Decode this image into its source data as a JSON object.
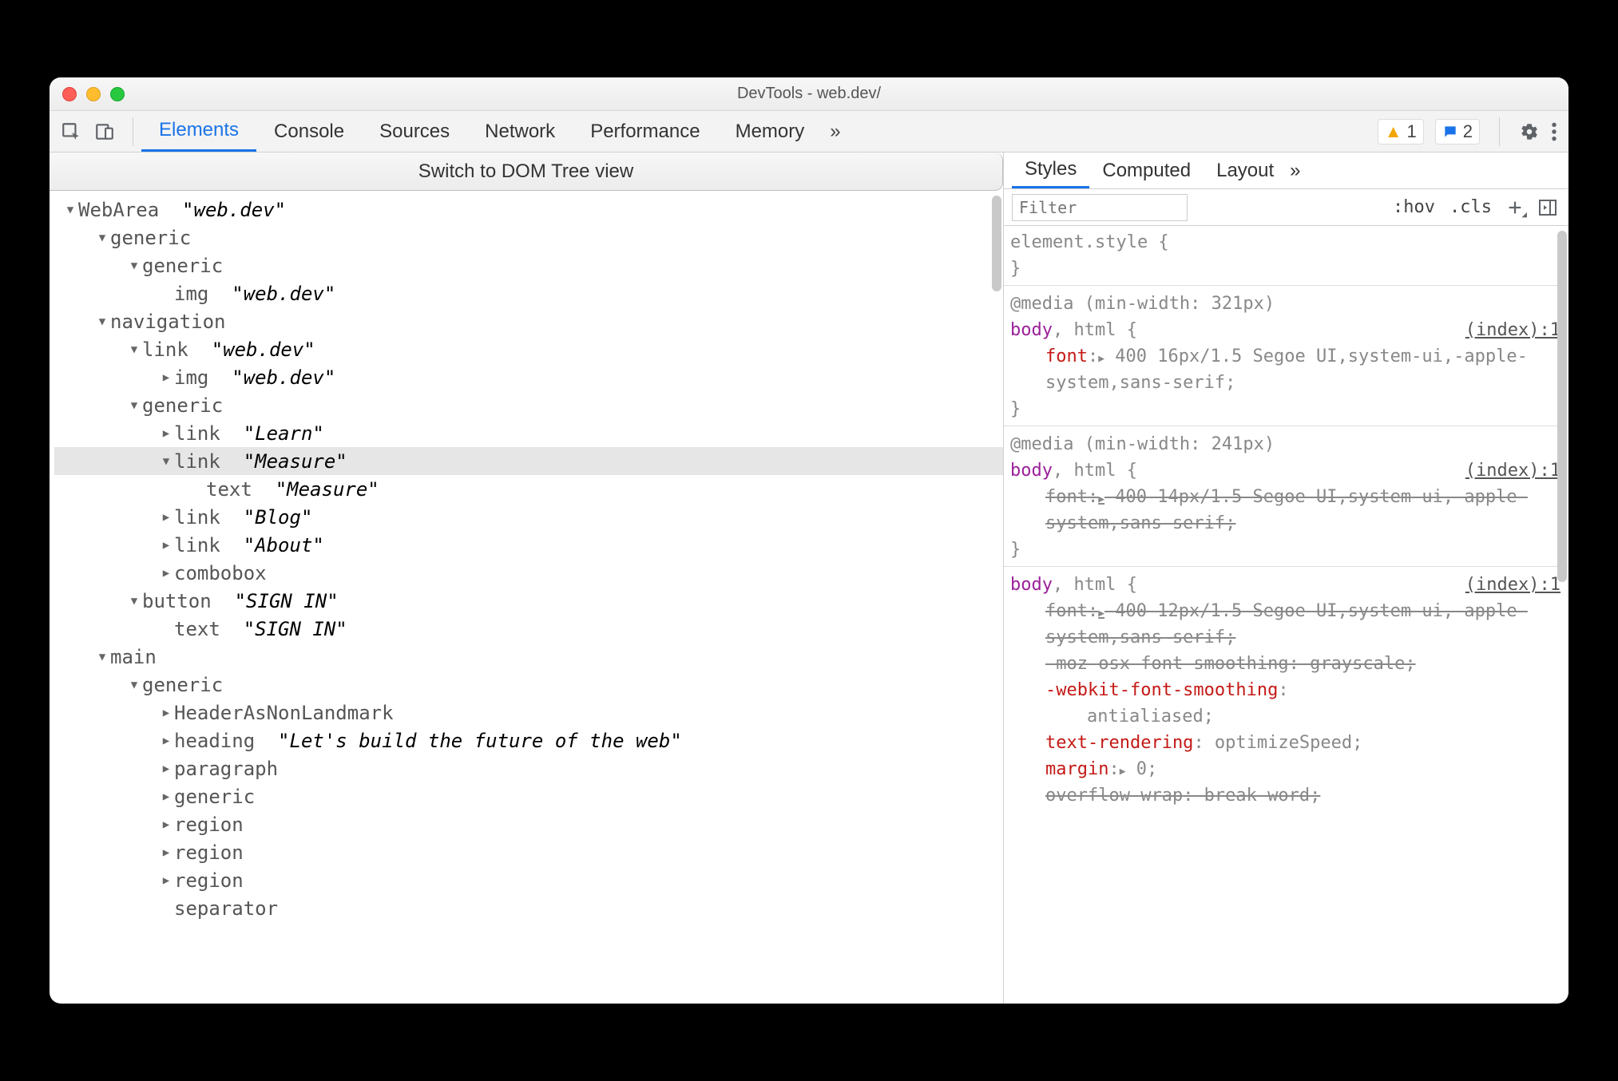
{
  "window": {
    "title": "DevTools - web.dev/"
  },
  "toolbar": {
    "tabs": [
      "Elements",
      "Console",
      "Sources",
      "Network",
      "Performance",
      "Memory"
    ],
    "active": 0,
    "more": "»",
    "warnings": "1",
    "messages": "2"
  },
  "switch_bar": "Switch to DOM Tree view",
  "tree": [
    {
      "d": 0,
      "a": "down",
      "txt": [
        "WebArea ",
        " \"web.dev\""
      ]
    },
    {
      "d": 1,
      "a": "down",
      "txt": [
        "generic",
        ""
      ]
    },
    {
      "d": 2,
      "a": "down",
      "txt": [
        "generic",
        ""
      ]
    },
    {
      "d": 3,
      "a": "none",
      "txt": [
        "img ",
        " \"web.dev\""
      ]
    },
    {
      "d": 1,
      "a": "down",
      "txt": [
        "navigation",
        ""
      ]
    },
    {
      "d": 2,
      "a": "down",
      "txt": [
        "link ",
        " \"web.dev\""
      ]
    },
    {
      "d": 3,
      "a": "right",
      "txt": [
        "img ",
        " \"web.dev\""
      ]
    },
    {
      "d": 2,
      "a": "down",
      "txt": [
        "generic",
        ""
      ]
    },
    {
      "d": 3,
      "a": "right",
      "txt": [
        "link ",
        " \"Learn\""
      ]
    },
    {
      "d": 3,
      "a": "down",
      "sel": true,
      "txt": [
        "link ",
        " \"Measure\""
      ]
    },
    {
      "d": 4,
      "a": "none",
      "txt": [
        "text ",
        " \"Measure\""
      ]
    },
    {
      "d": 3,
      "a": "right",
      "txt": [
        "link ",
        " \"Blog\""
      ]
    },
    {
      "d": 3,
      "a": "right",
      "txt": [
        "link ",
        " \"About\""
      ]
    },
    {
      "d": 3,
      "a": "right",
      "txt": [
        "combobox",
        ""
      ]
    },
    {
      "d": 2,
      "a": "down",
      "txt": [
        "button ",
        " \"SIGN IN\""
      ]
    },
    {
      "d": 3,
      "a": "none",
      "txt": [
        "text ",
        " \"SIGN IN\""
      ]
    },
    {
      "d": 1,
      "a": "down",
      "txt": [
        "main",
        ""
      ]
    },
    {
      "d": 2,
      "a": "down",
      "txt": [
        "generic",
        ""
      ]
    },
    {
      "d": 3,
      "a": "right",
      "txt": [
        "HeaderAsNonLandmark",
        ""
      ]
    },
    {
      "d": 3,
      "a": "right",
      "txt": [
        "heading ",
        " \"Let's build the future of the web\""
      ]
    },
    {
      "d": 3,
      "a": "right",
      "txt": [
        "paragraph",
        ""
      ]
    },
    {
      "d": 3,
      "a": "right",
      "txt": [
        "generic",
        ""
      ]
    },
    {
      "d": 3,
      "a": "right",
      "txt": [
        "region",
        ""
      ]
    },
    {
      "d": 3,
      "a": "right",
      "txt": [
        "region",
        ""
      ]
    },
    {
      "d": 3,
      "a": "right",
      "txt": [
        "region",
        ""
      ]
    },
    {
      "d": 3,
      "a": "none",
      "txt": [
        "separator",
        ""
      ]
    }
  ],
  "right": {
    "tabs": [
      "Styles",
      "Computed",
      "Layout"
    ],
    "active": 0,
    "more": "»",
    "filter_placeholder": "Filter",
    "toolbar_items": [
      ":hov",
      ".cls"
    ]
  },
  "styles": {
    "element_style_open": "element.style {",
    "brace_close": "}",
    "media1": "@media (min-width: 321px)",
    "media2": "@media (min-width: 241px)",
    "selector_body": "body",
    "selector_html": "html",
    "selector_brace": " {",
    "src": "(index):1",
    "font_prop": "font",
    "font16": " 400 16px/1.5 Segoe UI,system-ui,-apple-system,sans-serif;",
    "font14": " 400 14px/1.5 Segoe UI,system-ui,-apple-system,sans-serif;",
    "font12": " 400 12px/1.5 Segoe UI,system-ui,-apple-system,sans-serif;",
    "moz": "-moz-osx-font-smoothing",
    "moz_val": ": grayscale;",
    "webkit": "-webkit-font-smoothing",
    "webkit_val": "antialiased;",
    "textr": "text-rendering",
    "textr_val": ": optimizeSpeed;",
    "margin": "margin",
    "margin_val": " 0;",
    "ovf": "overflow-wrap",
    "ovf_val": ": break-word;"
  }
}
